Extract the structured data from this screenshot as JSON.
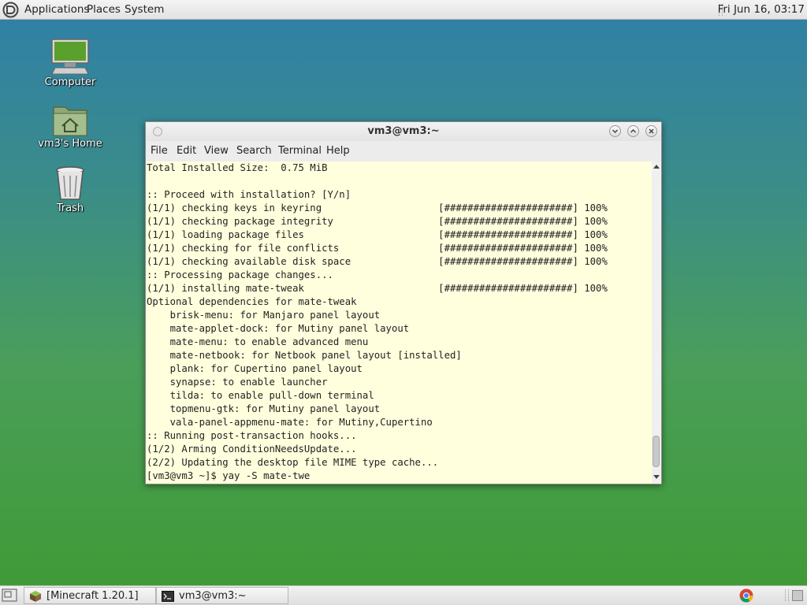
{
  "top_panel": {
    "menus": [
      "Applications",
      "Places",
      "System"
    ],
    "clock": "Fri Jun 16, 03:17"
  },
  "desktop_icons": [
    {
      "label": "Computer",
      "icon": "computer-icon"
    },
    {
      "label": "vm3's Home",
      "icon": "home-folder-icon"
    },
    {
      "label": "Trash",
      "icon": "trash-icon"
    }
  ],
  "terminal": {
    "title": "vm3@vm3:~",
    "menu": [
      "File",
      "Edit",
      "View",
      "Search",
      "Terminal",
      "Help"
    ],
    "lines": [
      "Total Installed Size:  0.75 MiB",
      "",
      ":: Proceed with installation? [Y/n]",
      "(1/1) checking keys in keyring                    [######################] 100%",
      "(1/1) checking package integrity                  [######################] 100%",
      "(1/1) loading package files                       [######################] 100%",
      "(1/1) checking for file conflicts                 [######################] 100%",
      "(1/1) checking available disk space               [######################] 100%",
      ":: Processing package changes...",
      "(1/1) installing mate-tweak                       [######################] 100%",
      "Optional dependencies for mate-tweak",
      "    brisk-menu: for Manjaro panel layout",
      "    mate-applet-dock: for Mutiny panel layout",
      "    mate-menu: to enable advanced menu",
      "    mate-netbook: for Netbook panel layout [installed]",
      "    plank: for Cupertino panel layout",
      "    synapse: to enable launcher",
      "    tilda: to enable pull-down terminal",
      "    topmenu-gtk: for Mutiny panel layout",
      "    vala-panel-appmenu-mate: for Mutiny,Cupertino",
      ":: Running post-transaction hooks...",
      "(1/2) Arming ConditionNeedsUpdate...",
      "(2/2) Updating the desktop file MIME type cache...",
      "[vm3@vm3 ~]$ yay -S mate-twe"
    ]
  },
  "taskbar": {
    "tasks": [
      {
        "label": "[Minecraft 1.20.1]",
        "icon": "minecraft-icon"
      },
      {
        "label": "vm3@vm3:~",
        "icon": "terminal-icon"
      }
    ]
  },
  "colors": {
    "terminal_bg": "#ffffdd",
    "desktop_top": "#2f7fa8",
    "desktop_bottom": "#3f9a33"
  }
}
